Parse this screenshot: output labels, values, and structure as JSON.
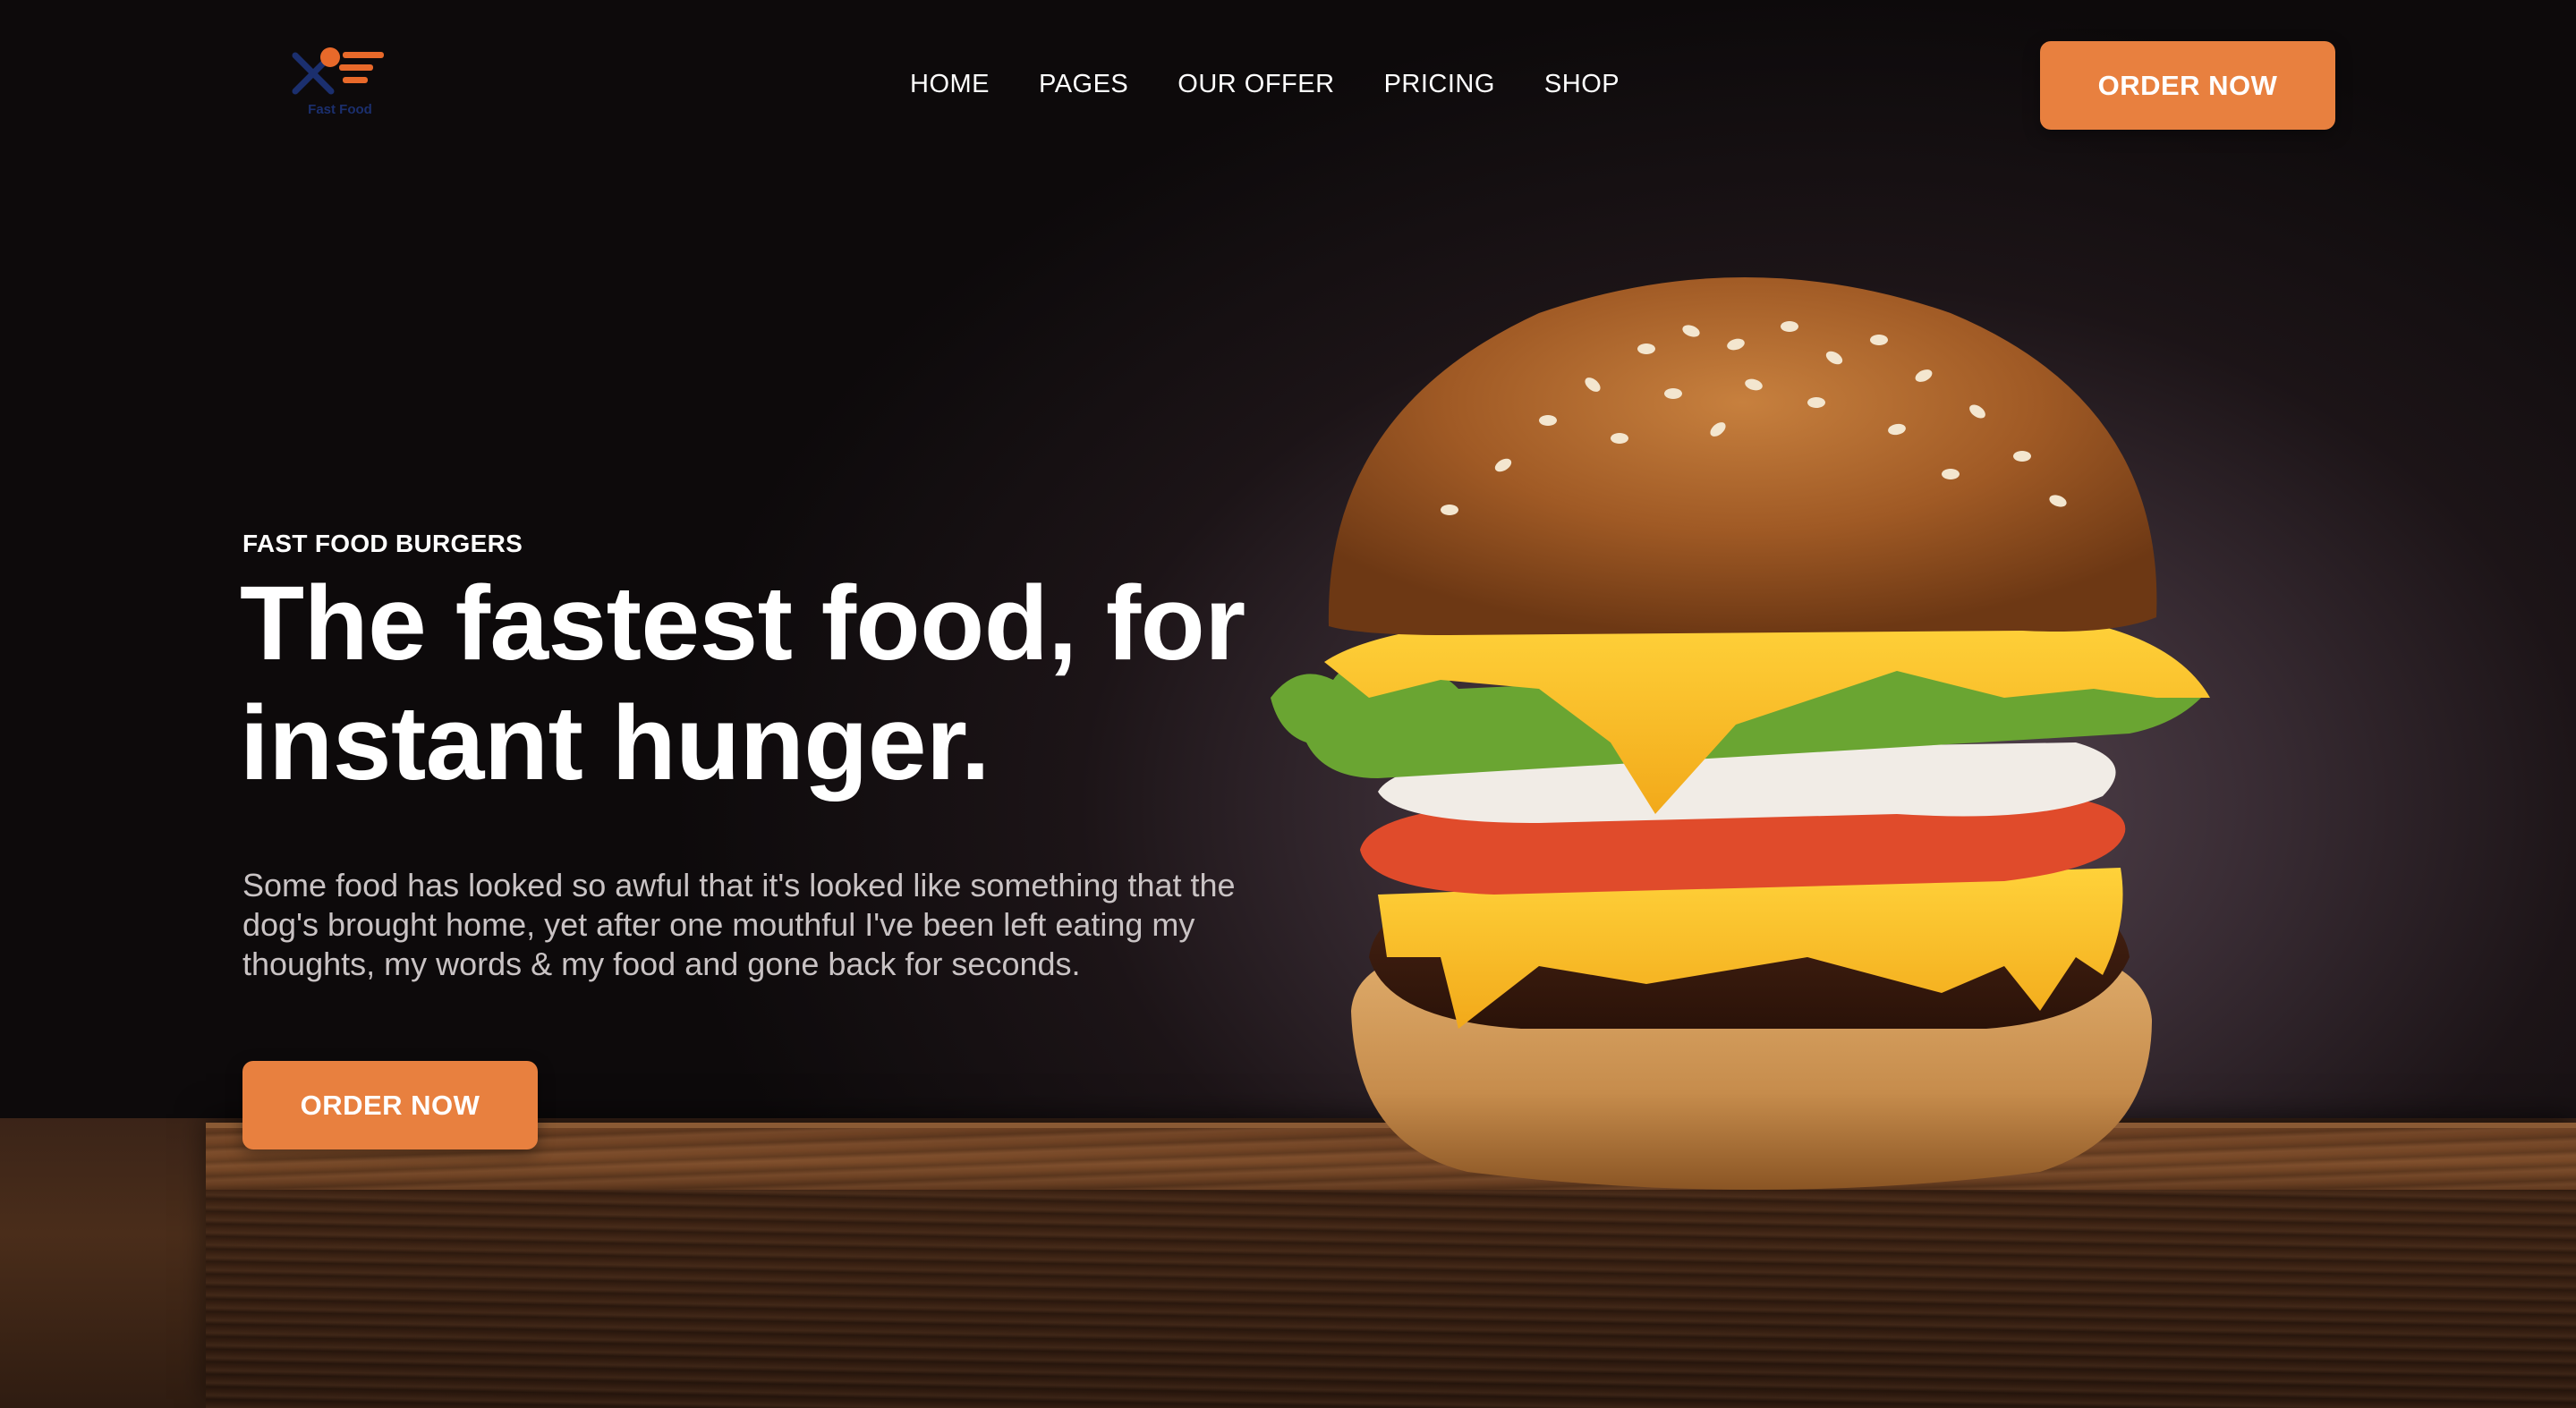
{
  "header": {
    "logo_text": "Fast Food",
    "nav": [
      {
        "label": "HOME"
      },
      {
        "label": "PAGES"
      },
      {
        "label": "OUR OFFER"
      },
      {
        "label": "PRICING"
      },
      {
        "label": "SHOP"
      }
    ],
    "cta_label": "ORDER NOW"
  },
  "hero": {
    "eyebrow": "FAST FOOD BURGERS",
    "headline_line1": "The fastest food, for",
    "headline_line2": "instant hunger.",
    "description": "Some food has looked so awful that it's looked like something that the dog's brought home, yet after one mouthful I've been left eating my thoughts, my words & my food and gone back for seconds.",
    "cta_label": "ORDER NOW"
  },
  "colors": {
    "accent": "#e8803f",
    "background": "#0b0909",
    "logo_blue": "#1b2f6e",
    "logo_orange": "#e8692a"
  },
  "icons": {
    "logo": "fork-spoon-speed-icon"
  }
}
